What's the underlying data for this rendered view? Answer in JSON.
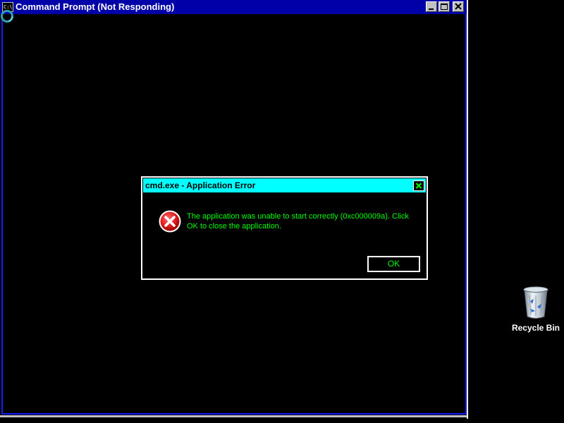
{
  "cmd_window": {
    "title": "Command Prompt (Not Responding)",
    "app_icon_text": "C:\\"
  },
  "dialog": {
    "title": "cmd.exe - Application Error",
    "message": "The application was unable to start correctly (0xc000009a). Click OK to close the application.",
    "ok_label": "OK"
  },
  "desktop": {
    "recycle_bin_label": "Recycle Bin"
  },
  "icons": {
    "app": "cmd-icon",
    "minimize": "minimize-icon",
    "maximize": "maximize-icon",
    "close": "close-icon",
    "error": "error-icon",
    "busy_cursor": "busy-cursor-icon",
    "recycle_bin": "recycle-bin-icon"
  },
  "colors": {
    "cmd_titlebar": "#0000a8",
    "dialog_titlebar": "#00ffff",
    "dialog_text": "#00ff00",
    "error_icon": "#e02020",
    "background": "#000000"
  }
}
